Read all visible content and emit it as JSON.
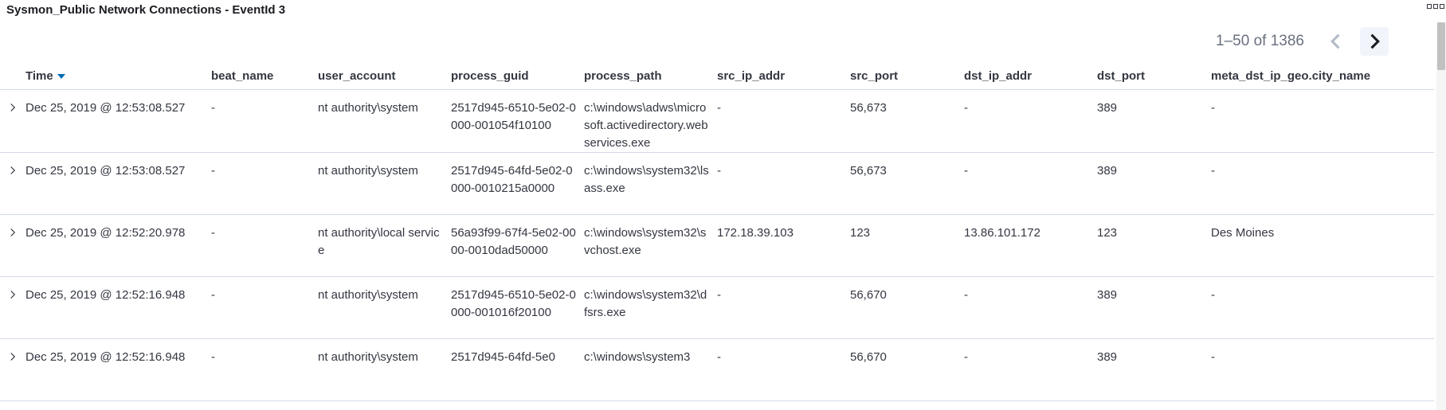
{
  "panel": {
    "title": "Sysmon_Public Network Connections - EventId 3"
  },
  "pagination": {
    "range_text": "1–50 of 1386"
  },
  "table": {
    "columns": [
      "Time",
      "beat_name",
      "user_account",
      "process_guid",
      "process_path",
      "src_ip_addr",
      "src_port",
      "dst_ip_addr",
      "dst_port",
      "meta_dst_ip_geo.city_name"
    ],
    "sort_column": "Time",
    "rows": [
      {
        "time": "Dec 25, 2019 @ 12:53:08.527",
        "beat_name": "-",
        "user_account": "nt authority\\system",
        "process_guid": "2517d945-6510-5e02-0000-001054f10100",
        "process_path": "c:\\windows\\adws\\microsoft.activedirectory.webservices.exe",
        "src_ip_addr": "-",
        "src_port": "56,673",
        "dst_ip_addr": "-",
        "dst_port": "389",
        "city": "-"
      },
      {
        "time": "Dec 25, 2019 @ 12:53:08.527",
        "beat_name": "-",
        "user_account": "nt authority\\system",
        "process_guid": "2517d945-64fd-5e02-0000-0010215a0000",
        "process_path": "c:\\windows\\system32\\lsass.exe",
        "src_ip_addr": "-",
        "src_port": "56,673",
        "dst_ip_addr": "-",
        "dst_port": "389",
        "city": "-"
      },
      {
        "time": "Dec 25, 2019 @ 12:52:20.978",
        "beat_name": "-",
        "user_account": "nt authority\\local service",
        "process_guid": "56a93f99-67f4-5e02-0000-0010dad50000",
        "process_path": "c:\\windows\\system32\\svchost.exe",
        "src_ip_addr": "172.18.39.103",
        "src_port": "123",
        "dst_ip_addr": "13.86.101.172",
        "dst_port": "123",
        "city": "Des Moines"
      },
      {
        "time": "Dec 25, 2019 @ 12:52:16.948",
        "beat_name": "-",
        "user_account": "nt authority\\system",
        "process_guid": "2517d945-6510-5e02-0000-001016f20100",
        "process_path": "c:\\windows\\system32\\dfsrs.exe",
        "src_ip_addr": "-",
        "src_port": "56,670",
        "dst_ip_addr": "-",
        "dst_port": "389",
        "city": "-"
      },
      {
        "time": "Dec 25, 2019 @ 12:52:16.948",
        "beat_name": "-",
        "user_account": "nt authority\\system",
        "process_guid": "2517d945-64fd-5e0",
        "process_path": "c:\\windows\\system3",
        "src_ip_addr": "-",
        "src_port": "56,670",
        "dst_ip_addr": "-",
        "dst_port": "389",
        "city": "-"
      }
    ]
  },
  "icons": {
    "prev": "chevron-left-icon",
    "next": "chevron-right-icon",
    "expand": "chevron-right-icon",
    "sort": "sort-down-icon",
    "menu": "panel-options-icon"
  },
  "colors": {
    "accent": "#006bb4",
    "border": "#d3dae6",
    "text": "#343741",
    "muted": "#69707d"
  }
}
